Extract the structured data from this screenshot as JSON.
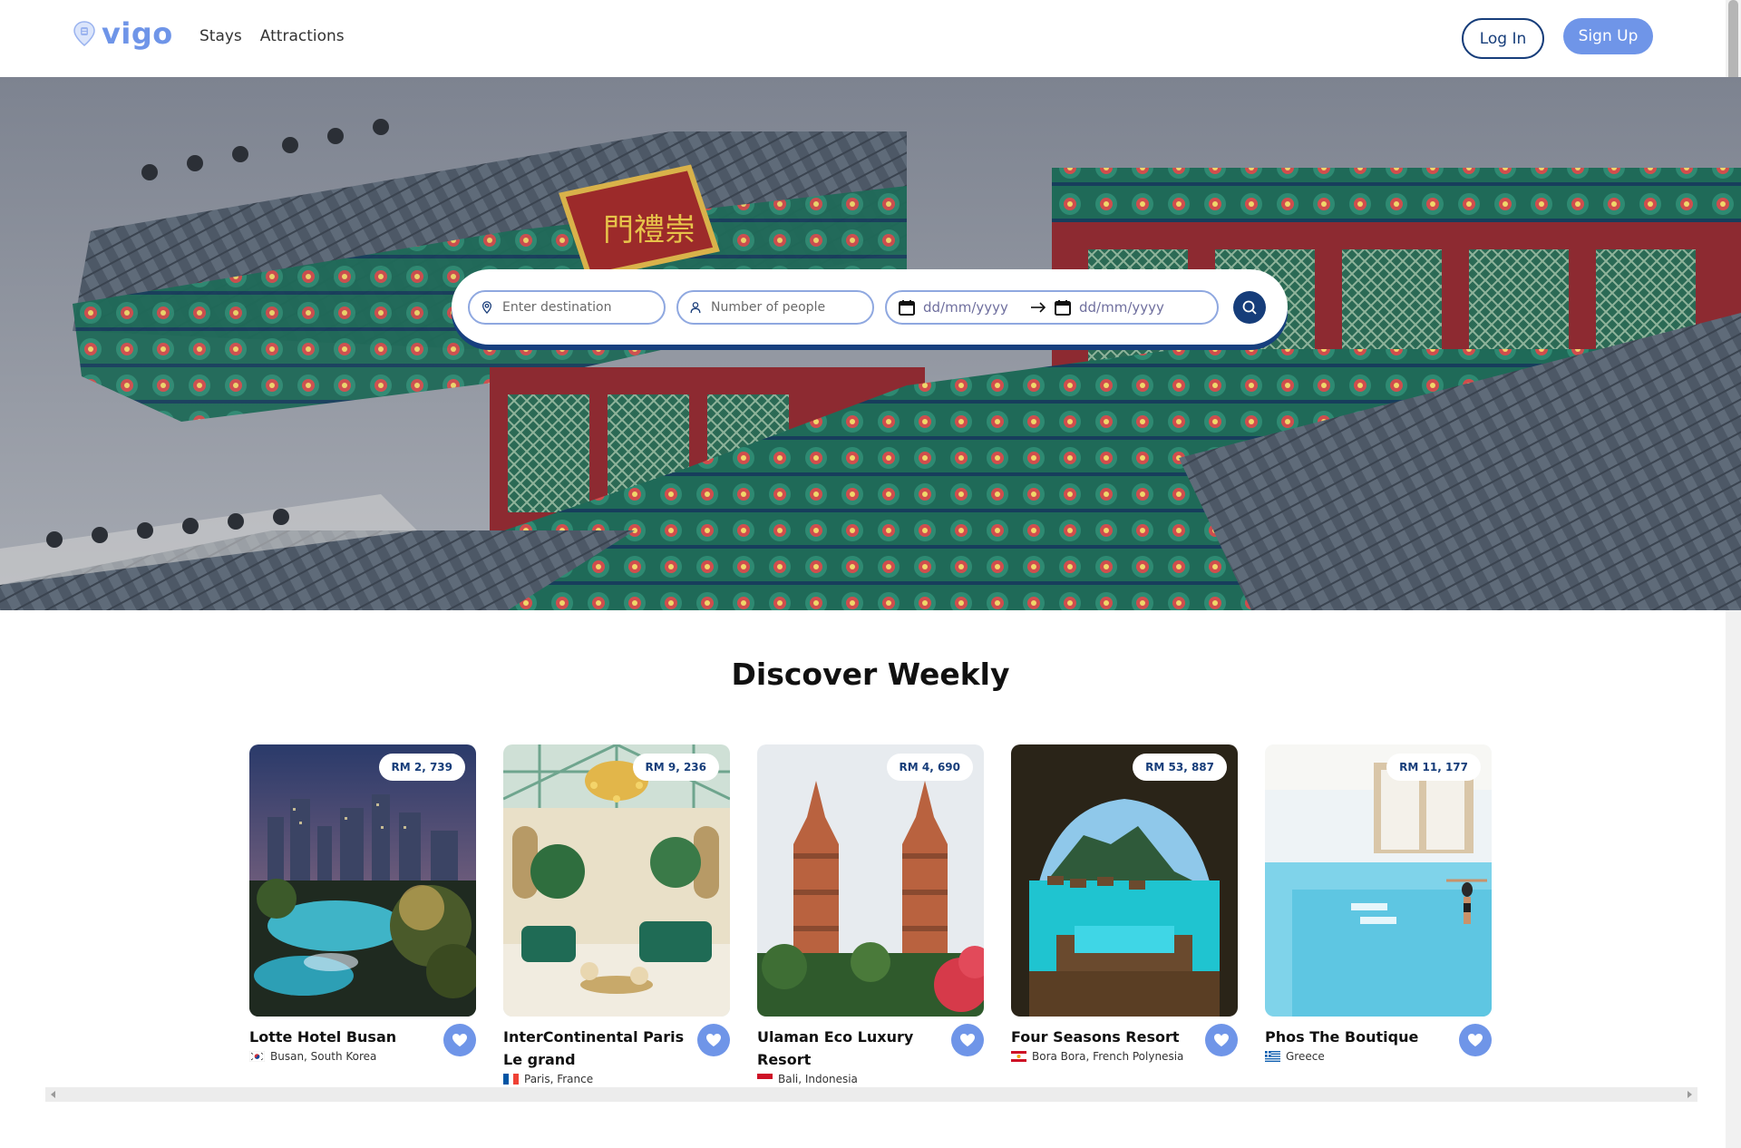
{
  "brand": {
    "name": "vigo",
    "color": "#6f95e8"
  },
  "nav": {
    "stays": "Stays",
    "attractions": "Attractions"
  },
  "auth": {
    "login": "Log In",
    "signup": "Sign Up"
  },
  "search": {
    "destination_placeholder": "Enter destination",
    "people_placeholder": "Number of people",
    "checkin": "dd/mm/yyyy",
    "checkout": "dd/mm/yyyy"
  },
  "discover": {
    "title": "Discover Weekly",
    "cards": [
      {
        "price": "RM 2, 739",
        "name": "Lotte Hotel Busan",
        "location": "Busan, South Korea",
        "flag": "south-korea"
      },
      {
        "price": "RM 9, 236",
        "name": "InterContinental Paris Le grand",
        "location": "Paris, France",
        "flag": "france"
      },
      {
        "price": "RM 4, 690",
        "name": "Ulaman Eco Luxury Resort",
        "location": "Bali, Indonesia",
        "flag": "indonesia"
      },
      {
        "price": "RM 53, 887",
        "name": "Four Seasons Resort",
        "location": "Bora Bora, French Polynesia",
        "flag": "french-polynesia"
      },
      {
        "price": "RM 11, 177",
        "name": "Phos The Boutique",
        "location": "Greece",
        "flag": "greece"
      }
    ]
  },
  "colors": {
    "primary": "#163d7a",
    "accent": "#6f95e8"
  }
}
